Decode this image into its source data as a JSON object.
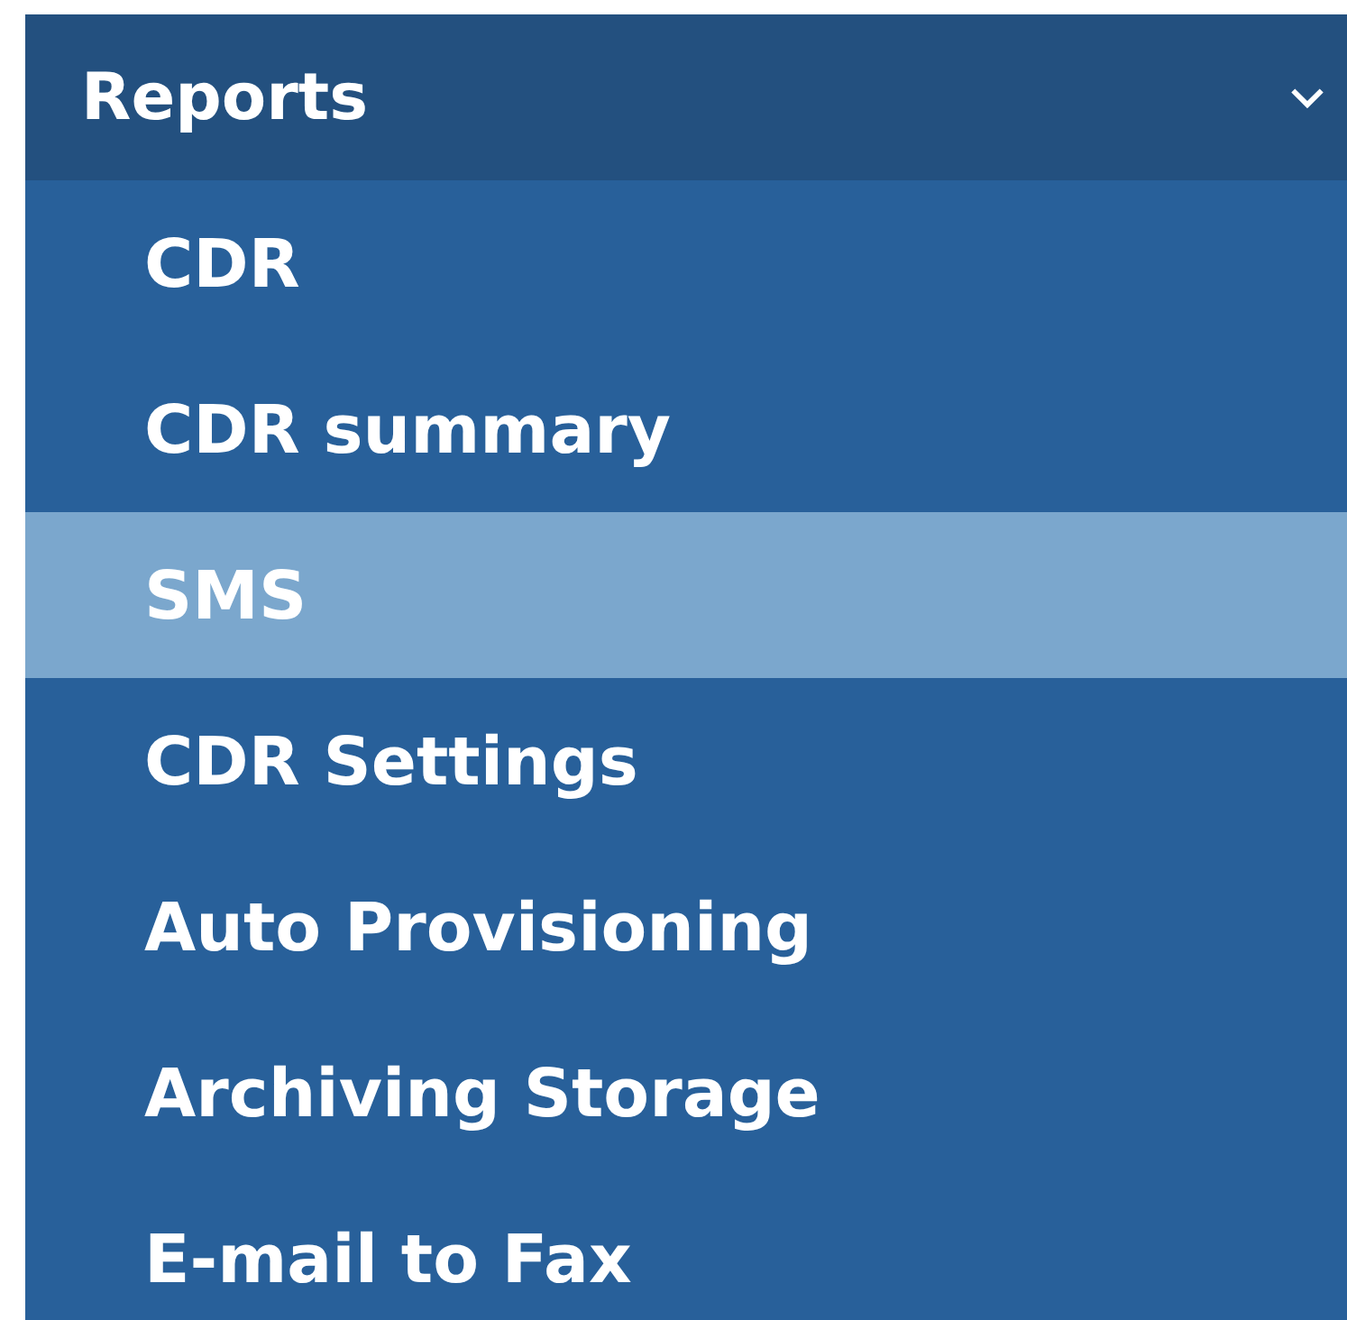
{
  "menu": {
    "title": "Reports",
    "expanded": true,
    "items": [
      {
        "label": "CDR",
        "selected": false
      },
      {
        "label": "CDR summary",
        "selected": false
      },
      {
        "label": "SMS",
        "selected": true
      },
      {
        "label": "CDR Settings",
        "selected": false
      },
      {
        "label": "Auto Provisioning",
        "selected": false
      },
      {
        "label": "Archiving Storage",
        "selected": false
      },
      {
        "label": "E-mail to Fax",
        "selected": false
      }
    ]
  }
}
